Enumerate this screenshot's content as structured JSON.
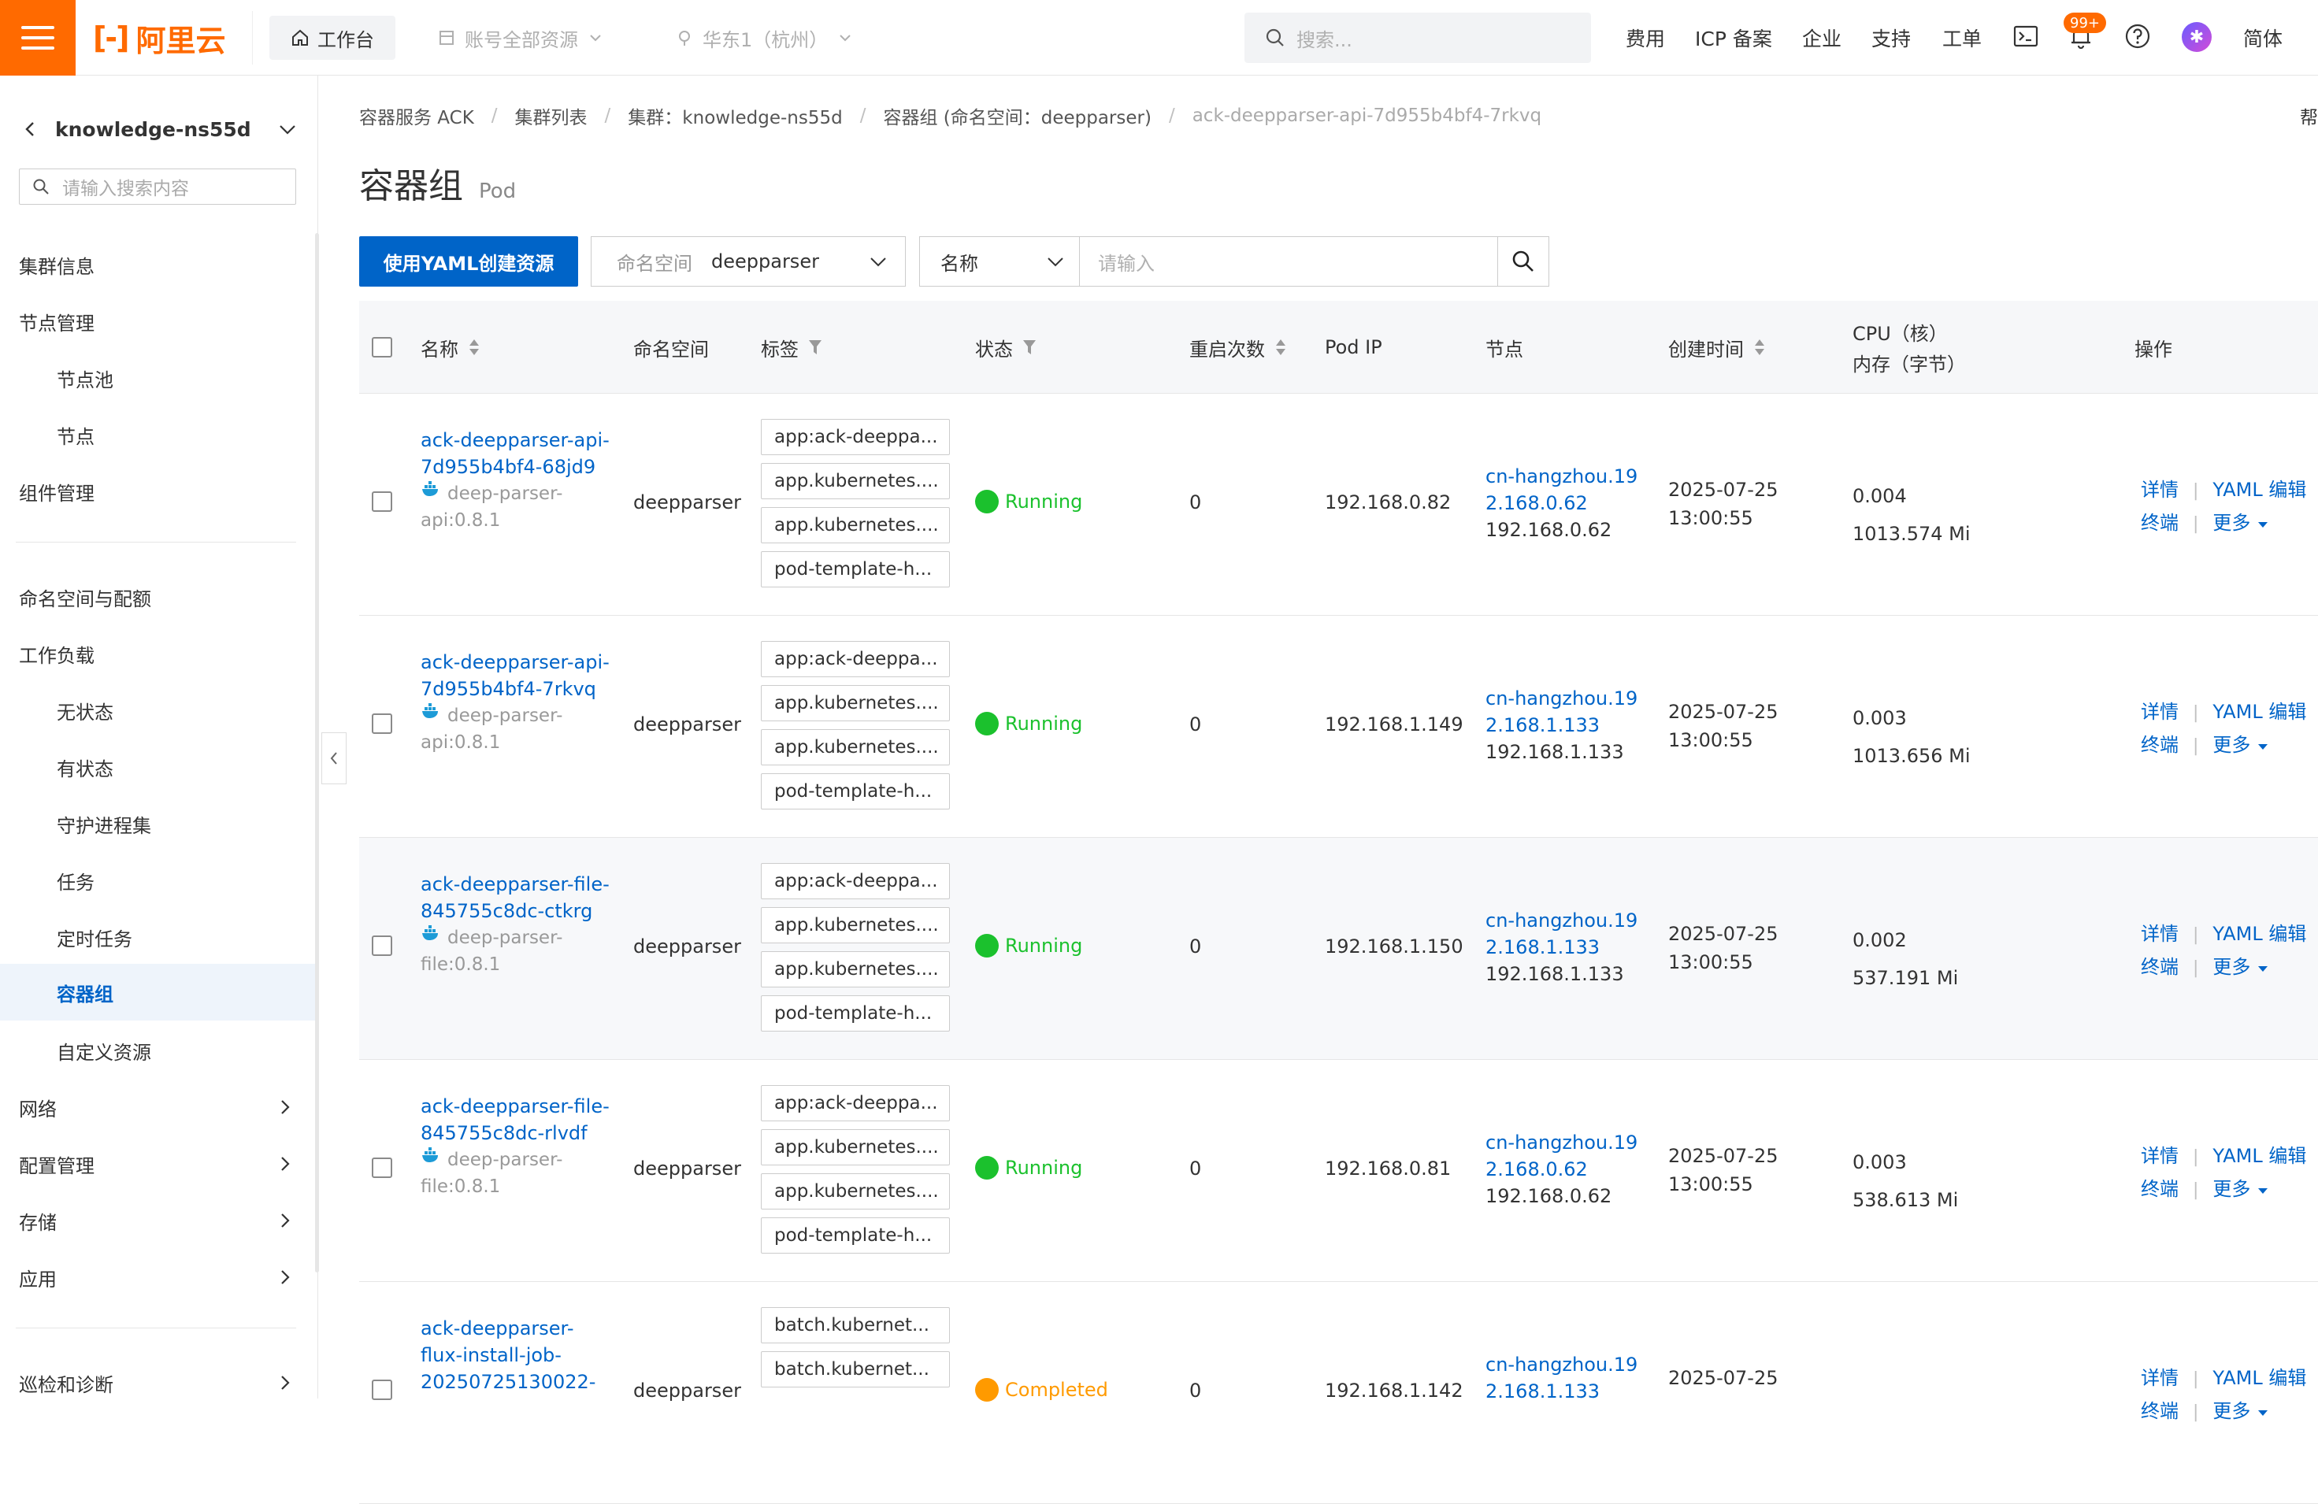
{
  "topbar": {
    "logo_text": "阿里云",
    "workbench": "工作台",
    "account_resources": "账号全部资源",
    "region": "华东1（杭州）",
    "search_placeholder": "搜索...",
    "links": [
      "费用",
      "ICP 备案",
      "企业",
      "支持",
      "工单"
    ],
    "notification_badge": "99+",
    "language": "简体"
  },
  "sidebar": {
    "cluster_name": "knowledge-ns55d",
    "search_placeholder": "请输入搜索内容",
    "items": [
      {
        "label": "集群信息"
      },
      {
        "label": "节点管理"
      },
      {
        "label": "节点池"
      },
      {
        "label": "节点"
      },
      {
        "label": "组件管理"
      },
      {
        "label": "命名空间与配额"
      },
      {
        "label": "工作负载"
      },
      {
        "label": "无状态"
      },
      {
        "label": "有状态"
      },
      {
        "label": "守护进程集"
      },
      {
        "label": "任务"
      },
      {
        "label": "定时任务"
      },
      {
        "label": "容器组"
      },
      {
        "label": "自定义资源"
      },
      {
        "label": "网络"
      },
      {
        "label": "配置管理"
      },
      {
        "label": "存储"
      },
      {
        "label": "应用"
      },
      {
        "label": "巡检和诊断"
      }
    ]
  },
  "breadcrumb": [
    "容器服务 ACK",
    "集群列表",
    "集群：knowledge-ns55d",
    "容器组 (命名空间：deepparser)",
    "ack-deepparser-api-7d955b4bf4-7rkvq"
  ],
  "help_edge": "帮",
  "page": {
    "title": "容器组",
    "subtitle": "Pod"
  },
  "toolbar": {
    "create_button": "使用YAML创建资源",
    "namespace_label": "命名空间",
    "namespace_value": "deepparser",
    "field_select": "名称",
    "search_placeholder": "请输入"
  },
  "table": {
    "headers": {
      "name": "名称",
      "namespace": "命名空间",
      "labels": "标签",
      "status": "状态",
      "restarts": "重启次数",
      "pod_ip": "Pod IP",
      "node": "节点",
      "created": "创建时间",
      "cpu": "CPU（核）",
      "memory": "内存（字节）",
      "actions": "操作"
    },
    "actions": {
      "detail": "详情",
      "yaml": "YAML 编辑",
      "terminal": "终端",
      "more": "更多"
    },
    "rows": [
      {
        "name1": "ack-deepparser-api-",
        "name2": "7d955b4bf4-68jd9",
        "name3": "",
        "image1": "deep-parser-",
        "image2": "api:0.8.1",
        "namespace": "deepparser",
        "labels": [
          "app:ack-deeppa...",
          "app.kubernetes....",
          "app.kubernetes....",
          "pod-template-h..."
        ],
        "status": "Running",
        "status_color": "#1bc12d",
        "restarts": "0",
        "pod_ip": "192.168.0.82",
        "node1": "cn-hangzhou.19",
        "node2": "2.168.0.62",
        "node3": "192.168.0.62",
        "created1": "2025-07-25",
        "created2": "13:00:55",
        "cpu": "0.004",
        "memory": "1013.574 Mi"
      },
      {
        "name1": "ack-deepparser-api-",
        "name2": "7d955b4bf4-7rkvq",
        "name3": "",
        "image1": "deep-parser-",
        "image2": "api:0.8.1",
        "namespace": "deepparser",
        "labels": [
          "app:ack-deeppa...",
          "app.kubernetes....",
          "app.kubernetes....",
          "pod-template-h..."
        ],
        "status": "Running",
        "status_color": "#1bc12d",
        "restarts": "0",
        "pod_ip": "192.168.1.149",
        "node1": "cn-hangzhou.19",
        "node2": "2.168.1.133",
        "node3": "192.168.1.133",
        "created1": "2025-07-25",
        "created2": "13:00:55",
        "cpu": "0.003",
        "memory": "1013.656 Mi"
      },
      {
        "name1": "ack-deepparser-file-",
        "name2": "845755c8dc-ctkrg",
        "name3": "",
        "image1": "deep-parser-",
        "image2": "file:0.8.1",
        "namespace": "deepparser",
        "labels": [
          "app:ack-deeppa...",
          "app.kubernetes....",
          "app.kubernetes....",
          "pod-template-h..."
        ],
        "status": "Running",
        "status_color": "#1bc12d",
        "restarts": "0",
        "pod_ip": "192.168.1.150",
        "node1": "cn-hangzhou.19",
        "node2": "2.168.1.133",
        "node3": "192.168.1.133",
        "created1": "2025-07-25",
        "created2": "13:00:55",
        "cpu": "0.002",
        "memory": "537.191 Mi"
      },
      {
        "name1": "ack-deepparser-file-",
        "name2": "845755c8dc-rlvdf",
        "name3": "",
        "image1": "deep-parser-",
        "image2": "file:0.8.1",
        "namespace": "deepparser",
        "labels": [
          "app:ack-deeppa...",
          "app.kubernetes....",
          "app.kubernetes....",
          "pod-template-h..."
        ],
        "status": "Running",
        "status_color": "#1bc12d",
        "restarts": "0",
        "pod_ip": "192.168.0.81",
        "node1": "cn-hangzhou.19",
        "node2": "2.168.0.62",
        "node3": "192.168.0.62",
        "created1": "2025-07-25",
        "created2": "13:00:55",
        "cpu": "0.003",
        "memory": "538.613 Mi"
      },
      {
        "name1": "ack-deepparser-",
        "name2": "flux-install-job-",
        "name3": "20250725130022-",
        "image1": "",
        "image2": "",
        "namespace": "deepparser",
        "labels": [
          "batch.kubernet...",
          "batch.kubernet..."
        ],
        "status": "Completed",
        "status_color": "#ff9a00",
        "restarts": "0",
        "pod_ip": "192.168.1.142",
        "node1": "cn-hangzhou.19",
        "node2": "2.168.1.133",
        "node3": "",
        "created1": "2025-07-25",
        "created2": "",
        "cpu": "",
        "memory": ""
      }
    ]
  }
}
